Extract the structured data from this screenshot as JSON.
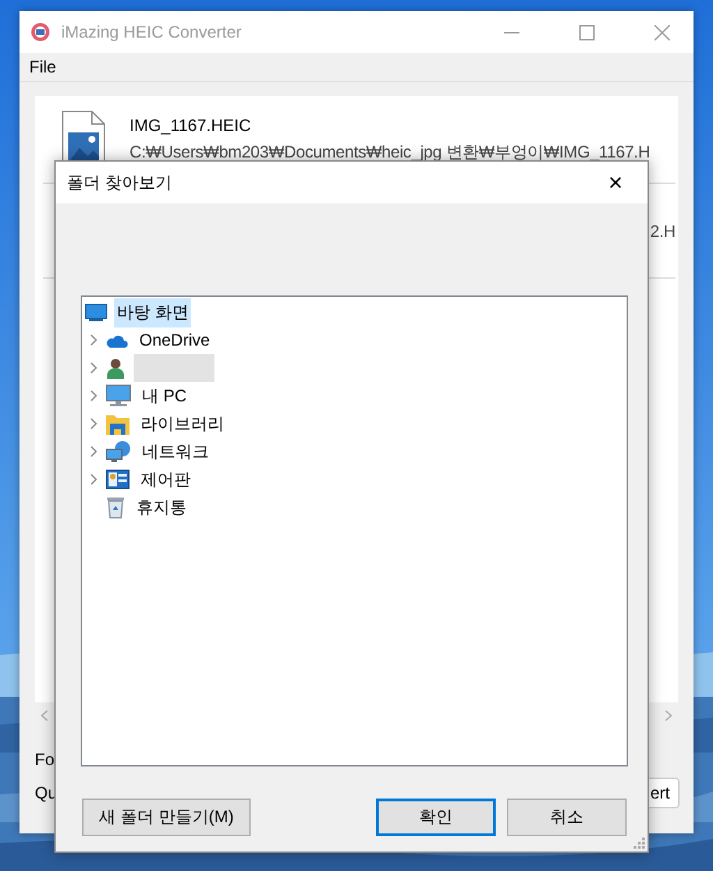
{
  "main_window": {
    "title": "iMazing HEIC Converter",
    "menu": [
      "File"
    ],
    "files": [
      {
        "name": "IMG_1167.HEIC",
        "path": "C:₩Users₩bm203₩Documents₩heic_jpg 변환₩부엉이₩IMG_1167.H"
      },
      {
        "path": "2.H"
      }
    ],
    "bottom_labels": [
      "Fo",
      "Qu"
    ],
    "convert_button": "ert"
  },
  "dialog": {
    "title": "폴더 찾아보기",
    "close": "×",
    "tree": [
      {
        "label": "바탕 화면",
        "kind": "desktop",
        "selected": true,
        "children": [
          {
            "label": "OneDrive",
            "kind": "cloud",
            "selected": false,
            "expandable": true
          },
          {
            "kind": "user",
            "selected": false,
            "expandable": true
          },
          {
            "label": "내 PC",
            "kind": "pc",
            "selected": false,
            "expandable": true
          },
          {
            "label": "라이브러리",
            "kind": "library",
            "selected": false,
            "expandable": true
          },
          {
            "label": "네트워크",
            "kind": "network",
            "selected": false,
            "expandable": true
          },
          {
            "label": "제어판",
            "kind": "control",
            "selected": false,
            "expandable": true
          },
          {
            "label": "휴지통",
            "kind": "trash",
            "selected": false,
            "expandable": false
          }
        ]
      }
    ],
    "buttons": [
      {
        "label": "새 폴더 만들기(M)",
        "default": false
      },
      {
        "label": "확인",
        "default": true
      },
      {
        "label": "취소",
        "default": false
      }
    ]
  }
}
